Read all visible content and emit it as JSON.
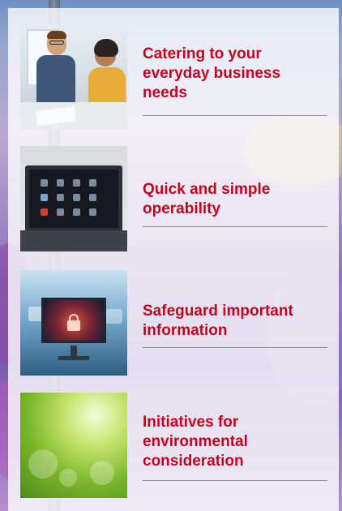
{
  "features": [
    {
      "title_lines": [
        "Catering to your",
        "everyday business",
        "needs"
      ]
    },
    {
      "title_lines": [
        "Quick and simple",
        "operability"
      ]
    },
    {
      "title_lines": [
        "Safeguard important",
        "information"
      ]
    },
    {
      "title_lines": [
        "Initiatives for",
        "environmental",
        "consideration"
      ]
    }
  ],
  "colors": {
    "accent": "#c7001f",
    "rule": "#8b8b8b",
    "panel": "#ffffff"
  }
}
